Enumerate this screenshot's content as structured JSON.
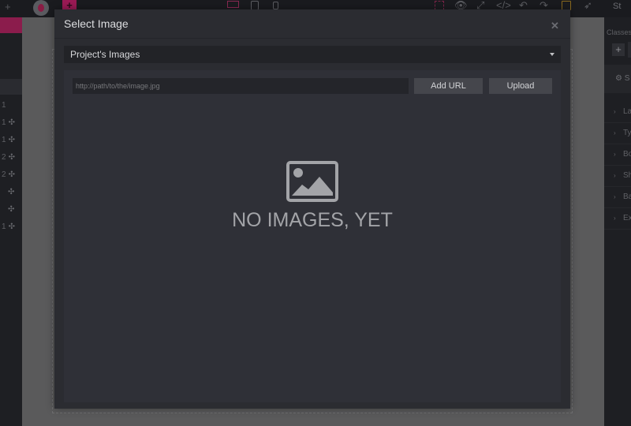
{
  "modal": {
    "title": "Select Image",
    "close_label": "✕",
    "source_select": {
      "selected": "Project's Images"
    },
    "url_input": {
      "placeholder": "http://path/to/the/image.jpg",
      "value": ""
    },
    "add_url_label": "Add URL",
    "upload_label": "Upload",
    "empty_state": {
      "icon": "image-icon",
      "text": "NO IMAGES, YET"
    }
  },
  "background": {
    "top_right_label": "St",
    "classes_label": "Classes",
    "settings_label": "S",
    "layer_rows": [
      {
        "num": "1",
        "icon": ""
      },
      {
        "num": "1",
        "icon": "✣"
      },
      {
        "num": "1",
        "icon": "✣"
      },
      {
        "num": "2",
        "icon": "✣"
      },
      {
        "num": "2",
        "icon": "✣"
      },
      {
        "num": "",
        "icon": "✣"
      },
      {
        "num": "",
        "icon": "✣"
      },
      {
        "num": "1",
        "icon": "✣"
      }
    ],
    "right_sections": [
      "La",
      "Ty",
      "Bo",
      "Sh",
      "Ba",
      "Ex"
    ]
  },
  "colors": {
    "accent": "#d6337a",
    "modal_bg": "#2b2c31",
    "content_bg": "#2f3037"
  }
}
